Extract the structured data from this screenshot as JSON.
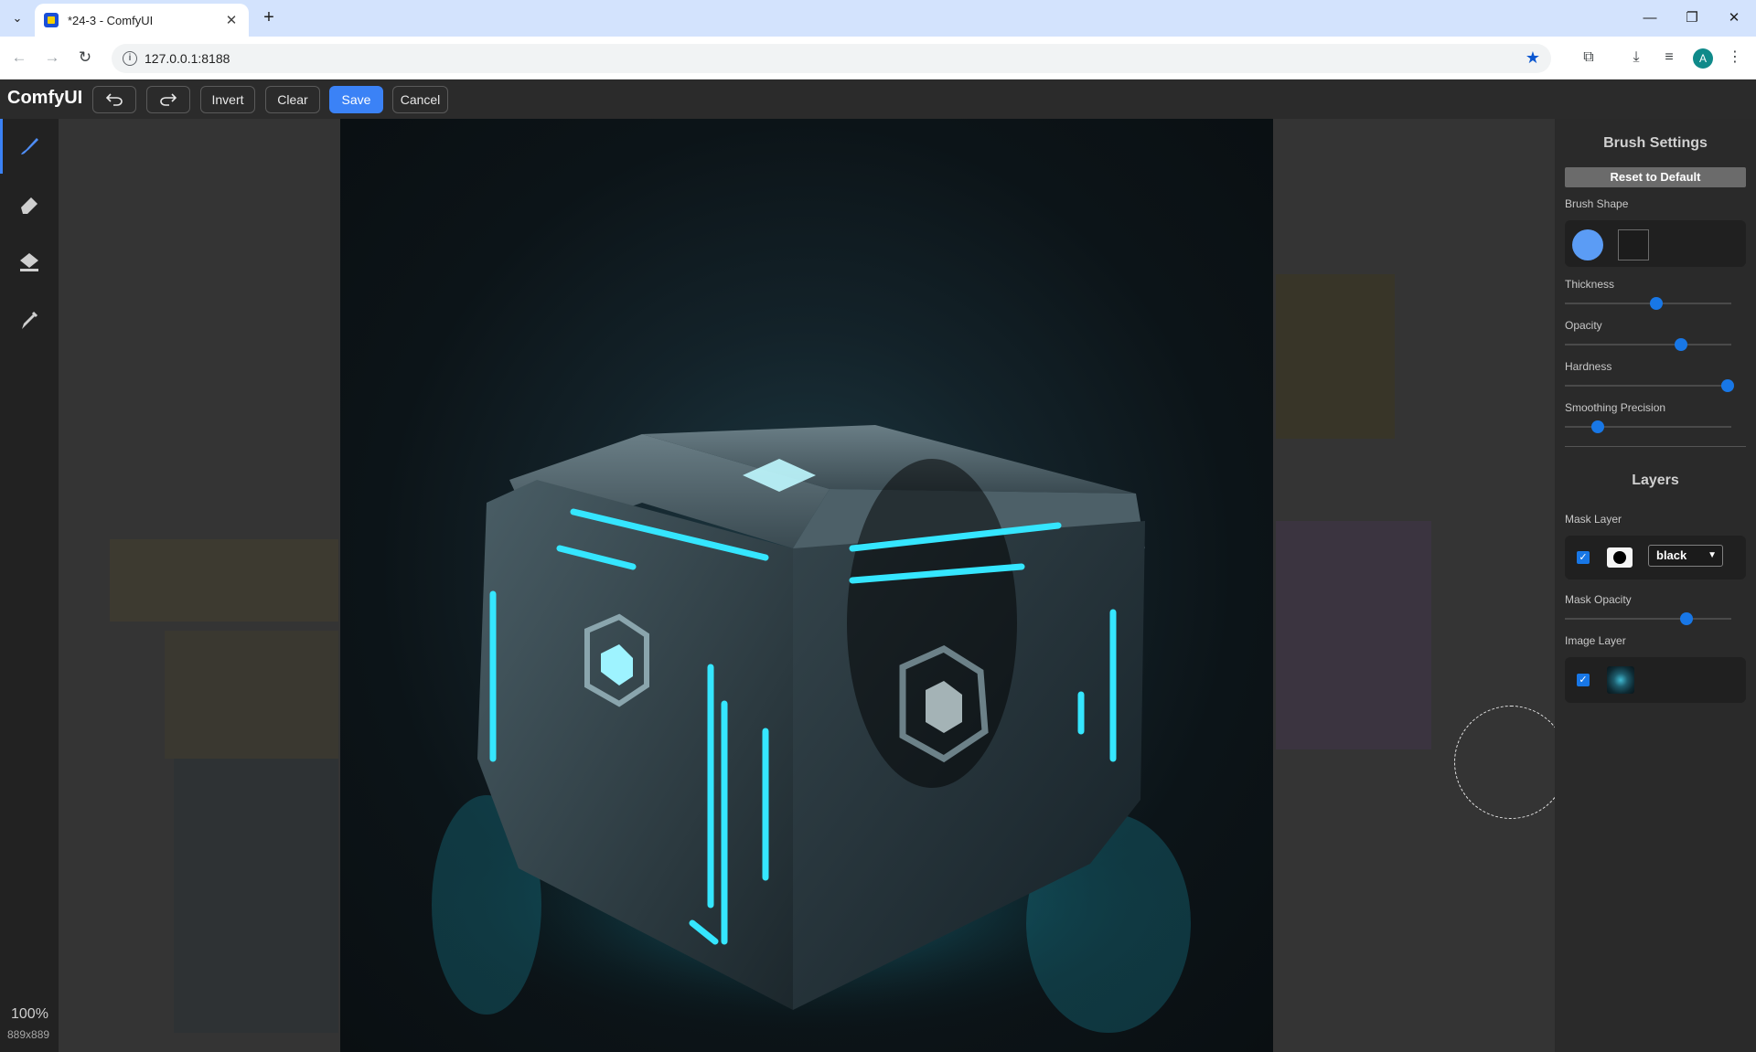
{
  "browser": {
    "tab_title": "*24-3 - ComfyUI",
    "url": "127.0.0.1:8188",
    "profile_initial": "A",
    "new_tab_label": "+"
  },
  "app": {
    "logo": "ComfyUI",
    "toolbar": {
      "invert_label": "Invert",
      "clear_label": "Clear",
      "save_label": "Save",
      "cancel_label": "Cancel"
    },
    "tools": [
      "brush-icon",
      "eraser-icon",
      "paint-bucket-icon",
      "color-picker-icon"
    ],
    "active_tool": "brush",
    "zoom": "100%",
    "image_size": "889x889"
  },
  "brush_settings": {
    "title": "Brush Settings",
    "reset_label": "Reset to Default",
    "shape_label": "Brush Shape",
    "selected_shape": "circle",
    "thickness_label": "Thickness",
    "thickness_value": 0.55,
    "opacity_label": "Opacity",
    "opacity_value": 0.7,
    "hardness_label": "Hardness",
    "hardness_value": 0.98,
    "smoothing_label": "Smoothing Precision",
    "smoothing_value": 0.2
  },
  "layers": {
    "title": "Layers",
    "mask_layer_label": "Mask Layer",
    "mask_layer_visible": true,
    "mask_color": "black",
    "mask_opacity_label": "Mask Opacity",
    "mask_opacity_value": 0.73,
    "image_layer_label": "Image Layer",
    "image_layer_visible": true
  },
  "colors": {
    "accent": "#3b82f6",
    "slider_thumb": "#1877e6",
    "glow": "#35e6ff"
  }
}
